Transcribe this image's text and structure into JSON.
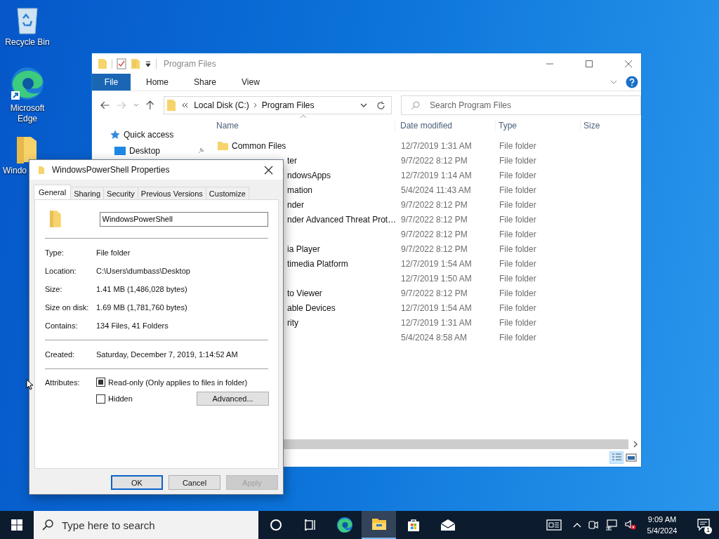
{
  "desktop_icons": [
    {
      "label": "Recycle Bin",
      "kind": "recycle"
    },
    {
      "label": "Microsoft Edge",
      "kind": "edge"
    },
    {
      "label": "Windo",
      "kind": "folder"
    }
  ],
  "explorer": {
    "title": "Program Files",
    "ribbon_tabs": [
      {
        "label": "File",
        "selected": true
      },
      {
        "label": "Home",
        "selected": false
      },
      {
        "label": "Share",
        "selected": false
      },
      {
        "label": "View",
        "selected": false
      }
    ],
    "breadcrumb": [
      "Local Disk (C:)",
      "Program Files"
    ],
    "search": {
      "placeholder": "Search Program Files"
    },
    "nav": [
      {
        "label": "Quick access",
        "kind": "star"
      },
      {
        "label": "Desktop",
        "kind": "desktop"
      }
    ],
    "columns": [
      "Name",
      "Date modified",
      "Type",
      "Size"
    ],
    "rows": [
      {
        "name": "Common Files",
        "partial": false,
        "date": "12/7/2019 1:31 AM",
        "type": "File folder"
      },
      {
        "name": "ter",
        "partial": true,
        "date": "9/7/2022 8:12 PM",
        "type": "File folder"
      },
      {
        "name": "ndowsApps",
        "partial": true,
        "date": "12/7/2019 1:14 AM",
        "type": "File folder"
      },
      {
        "name": "mation",
        "partial": true,
        "date": "5/4/2024 11:43 AM",
        "type": "File folder"
      },
      {
        "name": "nder",
        "partial": true,
        "date": "9/7/2022 8:12 PM",
        "type": "File folder"
      },
      {
        "name": "nder Advanced Threat Prot…",
        "partial": true,
        "date": "9/7/2022 8:12 PM",
        "type": "File folder"
      },
      {
        "date": "9/7/2022 8:12 PM",
        "type": "File folder"
      },
      {
        "name": "ia Player",
        "partial": true,
        "date": "9/7/2022 8:12 PM",
        "type": "File folder"
      },
      {
        "name": "timedia Platform",
        "partial": true,
        "date": "12/7/2019 1:54 AM",
        "type": "File folder"
      },
      {
        "date": "12/7/2019 1:50 AM",
        "type": "File folder"
      },
      {
        "name": "to Viewer",
        "partial": true,
        "date": "9/7/2022 8:12 PM",
        "type": "File folder"
      },
      {
        "name": "able Devices",
        "partial": true,
        "date": "12/7/2019 1:54 AM",
        "type": "File folder"
      },
      {
        "name": "rity",
        "partial": true,
        "date": "12/7/2019 1:31 AM",
        "type": "File folder"
      },
      {
        "date": "5/4/2024 8:58 AM",
        "type": "File folder"
      }
    ]
  },
  "dialog": {
    "title": "WindowsPowerShell Properties",
    "tabs": [
      {
        "label": "General",
        "selected": true
      },
      {
        "label": "Sharing",
        "selected": false
      },
      {
        "label": "Security",
        "selected": false
      },
      {
        "label": "Previous Versions",
        "selected": false
      },
      {
        "label": "Customize",
        "selected": false
      }
    ],
    "name_value": "WindowsPowerShell",
    "groups": [
      [
        {
          "label": "Type:",
          "value": "File folder"
        },
        {
          "label": "Location:",
          "value": "C:\\Users\\dumbass\\Desktop"
        },
        {
          "label": "Size:",
          "value": "1.41 MB (1,486,028 bytes)"
        },
        {
          "label": "Size on disk:",
          "value": "1.69 MB (1,781,760 bytes)"
        },
        {
          "label": "Contains:",
          "value": "134 Files, 41 Folders"
        }
      ],
      [
        {
          "label": "Created:",
          "value": "Saturday, December 7, 2019, 1:14:52 AM"
        }
      ]
    ],
    "attributes_label": "Attributes:",
    "attributes": [
      {
        "label": "Read-only (Only applies to files in folder)",
        "checked": true
      },
      {
        "label": "Hidden",
        "checked": false
      }
    ],
    "advanced_button": "Advanced...",
    "buttons": [
      {
        "label": "OK",
        "default": true,
        "disabled": false
      },
      {
        "label": "Cancel",
        "default": false,
        "disabled": false
      },
      {
        "label": "Apply",
        "default": false,
        "disabled": true
      }
    ]
  },
  "taskbar": {
    "search_placeholder": "Type here to search",
    "apps": [
      {
        "kind": "cortana",
        "active": false
      },
      {
        "kind": "taskview",
        "active": false
      },
      {
        "kind": "edge",
        "active": false
      },
      {
        "kind": "explorer",
        "active": true
      },
      {
        "kind": "store",
        "active": false
      },
      {
        "kind": "mail",
        "active": false
      }
    ],
    "tray": [
      {
        "kind": "news"
      },
      {
        "kind": "chevron"
      },
      {
        "kind": "meet"
      },
      {
        "kind": "network"
      },
      {
        "kind": "volume-muted"
      }
    ],
    "time": "9:09 AM",
    "date": "5/4/2024",
    "notifications": "1"
  }
}
